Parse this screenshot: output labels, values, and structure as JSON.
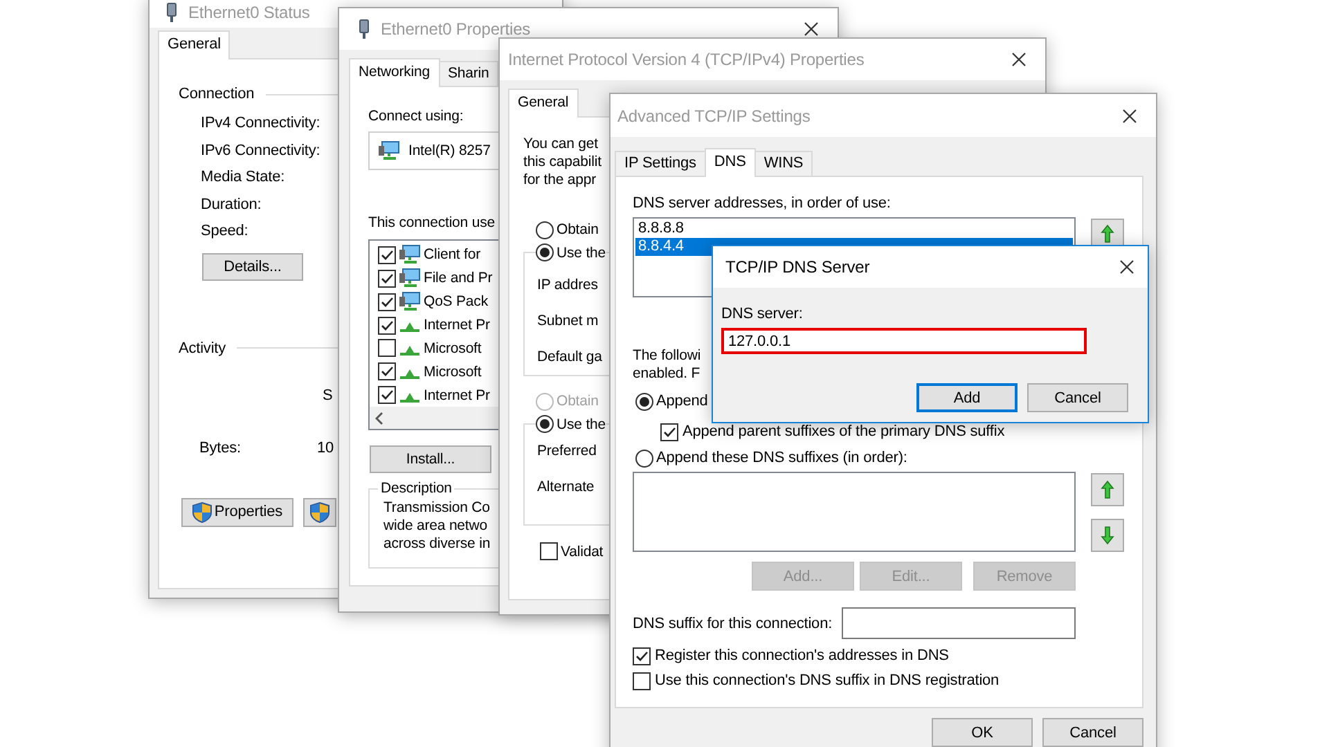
{
  "status_window": {
    "title": "Ethernet0 Status",
    "tabs": [
      {
        "label": "General",
        "selected": true
      }
    ],
    "connection": {
      "heading": "Connection",
      "fields": [
        "IPv4 Connectivity:",
        "IPv6 Connectivity:",
        "Media State:",
        "Duration:",
        "Speed:"
      ],
      "details_button": "Details..."
    },
    "activity": {
      "heading": "Activity",
      "column_label": "S",
      "bytes_label": "Bytes:",
      "bytes_value": "10"
    },
    "properties_button": "Properties"
  },
  "properties_window": {
    "title": "Ethernet0 Properties",
    "tabs": [
      {
        "label": "Networking",
        "selected": true
      },
      {
        "label": "Sharin",
        "selected": false
      }
    ],
    "connect_using_label": "Connect using:",
    "adapter": "Intel(R) 8257",
    "components_label": "This connection use",
    "components": [
      {
        "label": "Client for",
        "checked": true,
        "kind": "service"
      },
      {
        "label": "File and Pr",
        "checked": true,
        "kind": "service"
      },
      {
        "label": "QoS Pack",
        "checked": true,
        "kind": "service"
      },
      {
        "label": "Internet Pr",
        "checked": true,
        "kind": "protocol"
      },
      {
        "label": "Microsoft",
        "checked": false,
        "kind": "protocol"
      },
      {
        "label": "Microsoft",
        "checked": true,
        "kind": "protocol"
      },
      {
        "label": "Internet Pr",
        "checked": true,
        "kind": "protocol"
      }
    ],
    "install_button": "Install...",
    "description": {
      "heading": "Description",
      "lines": [
        "Transmission Co",
        "wide area netwo",
        "across diverse in"
      ]
    }
  },
  "ipv4_window": {
    "title": "Internet Protocol Version 4 (TCP/IPv4) Properties",
    "tabs": [
      {
        "label": "General",
        "selected": true
      }
    ],
    "intro_lines": [
      "You can get",
      "this capabilit",
      "for the appr"
    ],
    "ip_options": [
      {
        "label": "Obtain",
        "selected": false,
        "disabled": false
      },
      {
        "label": "Use the",
        "selected": true,
        "disabled": false
      }
    ],
    "ip_fields": [
      "IP addres",
      "Subnet m",
      "Default ga"
    ],
    "dns_options": [
      {
        "label": "Obtain",
        "selected": false,
        "disabled": true
      },
      {
        "label": "Use the",
        "selected": true,
        "disabled": false
      }
    ],
    "dns_fields": [
      "Preferred",
      "Alternate"
    ],
    "validate": {
      "label": "Validat",
      "checked": false
    }
  },
  "advanced_window": {
    "title": "Advanced TCP/IP Settings",
    "tabs": [
      {
        "label": "IP Settings",
        "selected": false
      },
      {
        "label": "DNS",
        "selected": true
      },
      {
        "label": "WINS",
        "selected": false
      }
    ],
    "servers_label": "DNS server addresses, in order of use:",
    "servers": [
      {
        "address": "8.8.8.8",
        "selected": false
      },
      {
        "address": "8.8.4.4",
        "selected": true
      }
    ],
    "info_lines": [
      "The followi",
      "enabled. F"
    ],
    "append_primary": {
      "label": "Append",
      "selected": true
    },
    "append_parent": {
      "label": "Append parent suffixes of the primary DNS suffix",
      "checked": true
    },
    "append_these": {
      "label": "Append these DNS suffixes (in order):",
      "selected": false
    },
    "suffix_buttons": [
      {
        "label": "Add...",
        "disabled": true
      },
      {
        "label": "Edit...",
        "disabled": true
      },
      {
        "label": "Remove",
        "disabled": true
      }
    ],
    "connection_suffix_label": "DNS suffix for this connection:",
    "checkboxes": [
      {
        "label": "Register this connection's addresses in DNS",
        "checked": true
      },
      {
        "label": "Use this connection's DNS suffix in DNS registration",
        "checked": false
      }
    ],
    "buttons": [
      {
        "label": "OK"
      },
      {
        "label": "Cancel"
      }
    ]
  },
  "dns_server_dialog": {
    "title": "TCP/IP DNS Server",
    "field_label": "DNS server:",
    "field": {
      "value": "127.0.0.1",
      "highlighted": true
    },
    "buttons": [
      {
        "label": "Add",
        "default": true
      },
      {
        "label": "Cancel",
        "default": false
      }
    ]
  }
}
